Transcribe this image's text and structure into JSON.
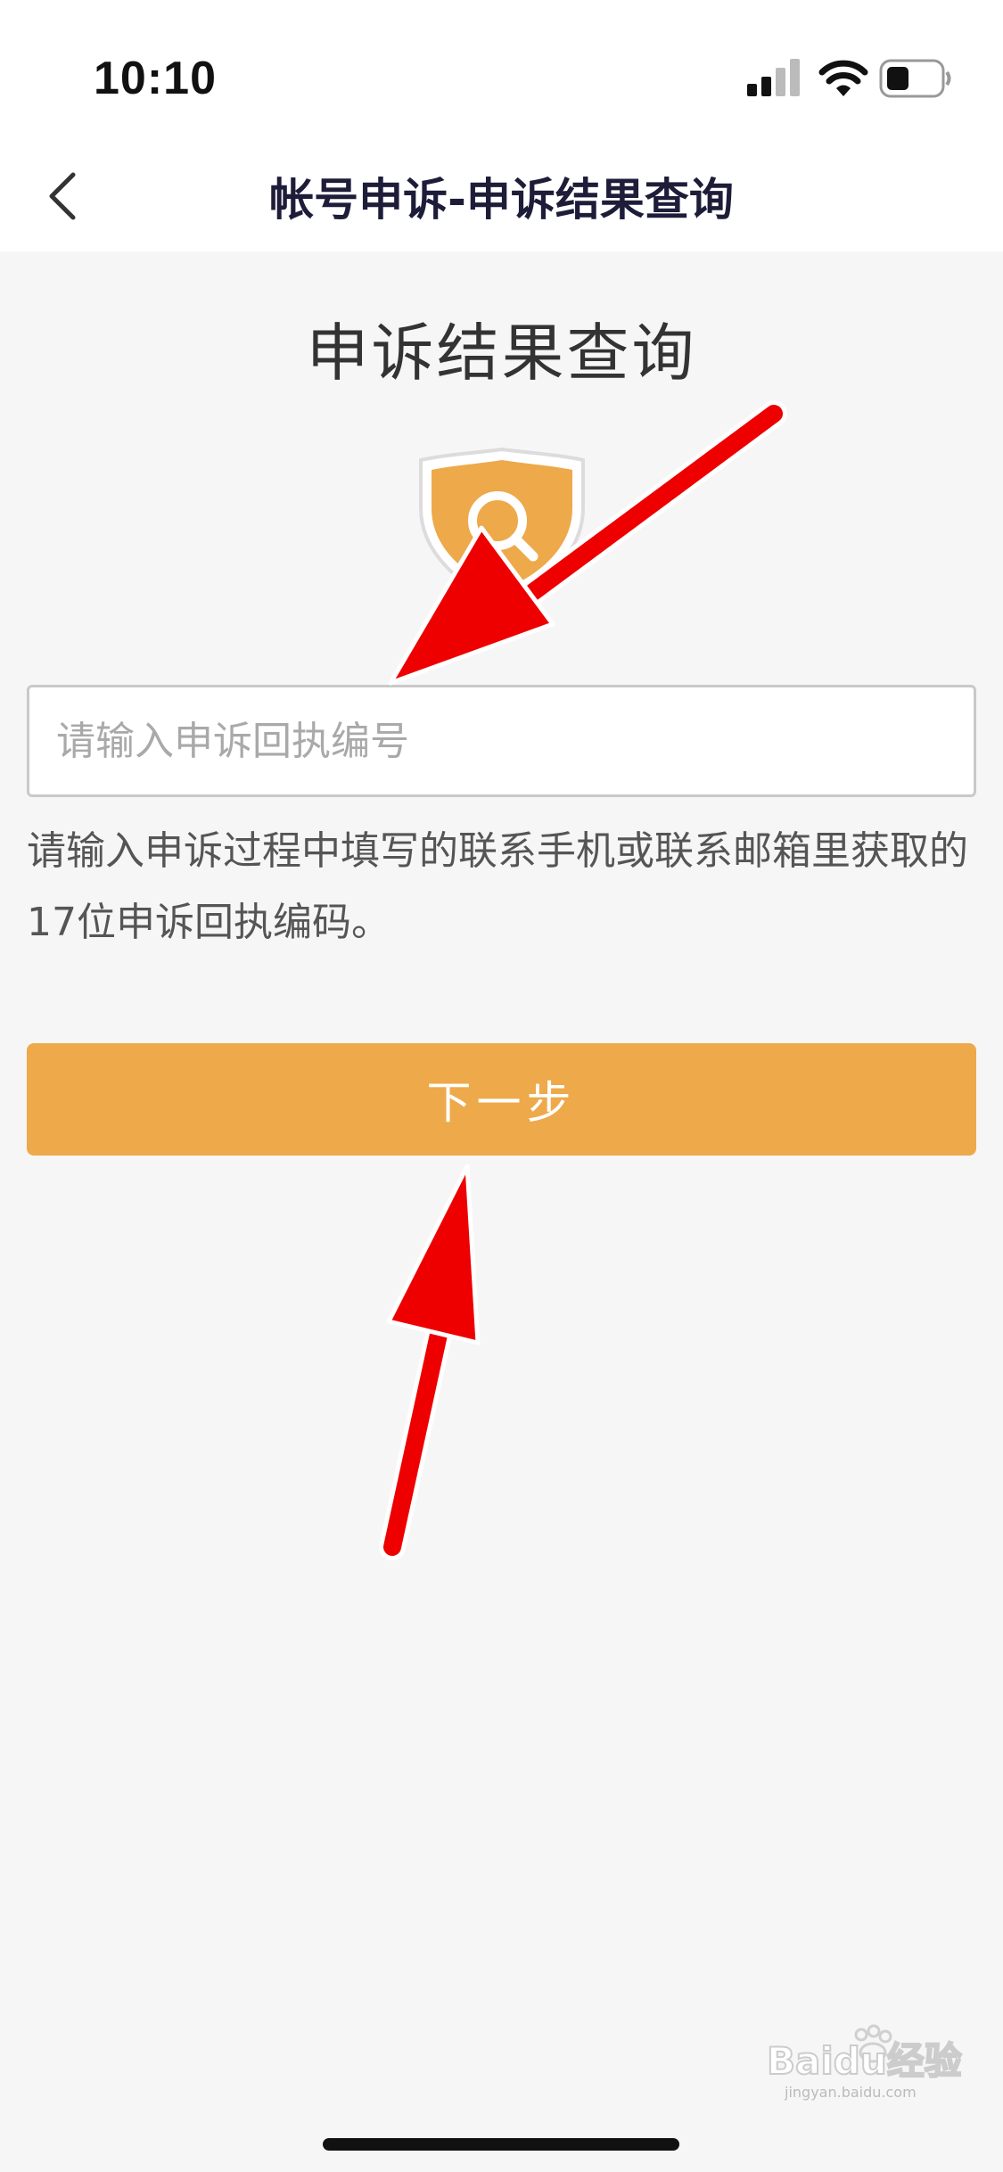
{
  "status_bar": {
    "time": "10:10",
    "icons": [
      "signal-icon",
      "wifi-icon",
      "battery-icon"
    ]
  },
  "nav": {
    "title": "帐号申诉-申诉结果查询",
    "back_icon": "chevron-left-icon"
  },
  "main": {
    "heading": "申诉结果查询",
    "emblem_icon": "shield-search-icon",
    "receipt_input": {
      "value": "",
      "placeholder": "请输入申诉回执编号"
    },
    "hint": "请输入申诉过程中填写的联系手机或联系邮箱里获取的17位申诉回执编码。",
    "next_button_label": "下一步"
  },
  "annotations": {
    "arrow_color": "#ee0000",
    "arrows": [
      "arrow-to-input",
      "arrow-to-next-button"
    ]
  },
  "watermark": {
    "text": "Baidu经验",
    "subtext": "jingyan.baidu.com"
  },
  "colors": {
    "accent": "#eea94a",
    "nav_title": "#1d1d3a",
    "background": "#f6f6f6"
  }
}
